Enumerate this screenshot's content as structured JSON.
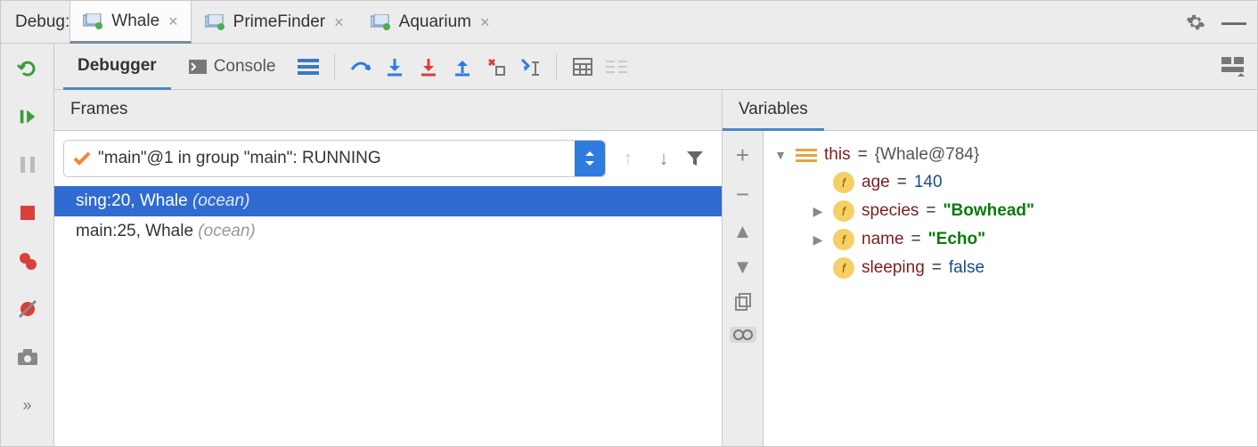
{
  "header": {
    "label": "Debug:"
  },
  "tabs": [
    {
      "label": "Whale",
      "active": true
    },
    {
      "label": "PrimeFinder",
      "active": false
    },
    {
      "label": "Aquarium",
      "active": false
    }
  ],
  "toolbar": {
    "debugger_label": "Debugger",
    "console_label": "Console"
  },
  "frames": {
    "title": "Frames",
    "thread": "\"main\"@1 in group \"main\": RUNNING",
    "stack": [
      {
        "method": "sing:20, Whale",
        "loc": "(ocean)",
        "selected": true
      },
      {
        "method": "main:25, Whale",
        "loc": "(ocean)",
        "selected": false
      }
    ]
  },
  "variables": {
    "title": "Variables",
    "root": {
      "name": "this",
      "value": "{Whale@784}"
    },
    "fields": [
      {
        "name": "age",
        "value": "140",
        "type": "num",
        "expandable": false
      },
      {
        "name": "species",
        "value": "\"Bowhead\"",
        "type": "str",
        "expandable": true
      },
      {
        "name": "name",
        "value": "\"Echo\"",
        "type": "str",
        "expandable": true
      },
      {
        "name": "sleeping",
        "value": "false",
        "type": "bool",
        "expandable": false
      }
    ]
  }
}
